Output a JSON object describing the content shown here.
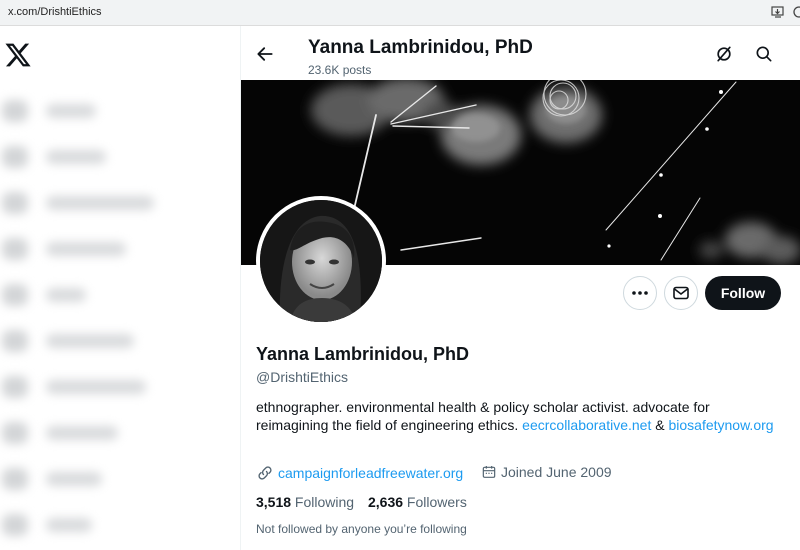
{
  "browser": {
    "url": "x.com/DrishtiEthics",
    "icons": [
      "install-app-icon",
      "extension-icon"
    ]
  },
  "sidebar": {
    "logo": "x-logo-icon",
    "items_blurred": 10
  },
  "header": {
    "name": "Yanna Lambrinidou, PhD",
    "posts": "23.6K posts",
    "icons": [
      "back-arrow-icon",
      "grok-icon",
      "search-icon"
    ]
  },
  "actions": {
    "more_icon": "more-icon",
    "message_icon": "message-icon",
    "follow_label": "Follow"
  },
  "profile": {
    "name": "Yanna Lambrinidou, PhD",
    "handle": "@DrishtiEthics",
    "bio_text": "ethnographer. environmental health & policy scholar activist. advocate for reimagining the field of engineering ethics. ",
    "bio_link1": "eecrcollaborative.net",
    "bio_amp": " & ",
    "bio_link2": "biosafetynow.org",
    "website": "campaignforleadfreewater.org",
    "joined": "Joined June 2009",
    "following_count": "3,518",
    "following_label": " Following",
    "followers_count": "2,636",
    "followers_label": " Followers",
    "not_followed": "Not followed by anyone you’re following"
  },
  "colors": {
    "link": "#1d9bf0",
    "text": "#0f1419",
    "secondary": "#536471",
    "follow_bg": "#0f1419"
  }
}
